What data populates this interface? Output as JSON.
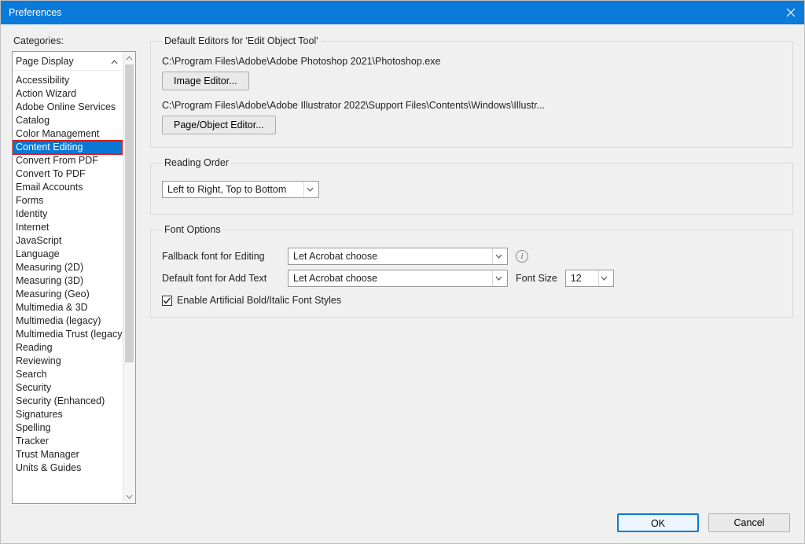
{
  "window_title": "Preferences",
  "categories_label": "Categories:",
  "categories_top": "Page Display",
  "categories": [
    "Accessibility",
    "Action Wizard",
    "Adobe Online Services",
    "Catalog",
    "Color Management",
    "Content Editing",
    "Convert From PDF",
    "Convert To PDF",
    "Email Accounts",
    "Forms",
    "Identity",
    "Internet",
    "JavaScript",
    "Language",
    "Measuring (2D)",
    "Measuring (3D)",
    "Measuring (Geo)",
    "Multimedia & 3D",
    "Multimedia (legacy)",
    "Multimedia Trust (legacy)",
    "Reading",
    "Reviewing",
    "Search",
    "Security",
    "Security (Enhanced)",
    "Signatures",
    "Spelling",
    "Tracker",
    "Trust Manager",
    "Units & Guides"
  ],
  "selected_category_index": 5,
  "editors": {
    "group_title": "Default Editors for 'Edit Object Tool'",
    "image_path": "C:\\Program Files\\Adobe\\Adobe Photoshop 2021\\Photoshop.exe",
    "image_button": "Image Editor...",
    "page_path": "C:\\Program Files\\Adobe\\Adobe Illustrator 2022\\Support Files\\Contents\\Windows\\Illustr...",
    "page_button": "Page/Object Editor..."
  },
  "reading_order": {
    "group_title": "Reading Order",
    "value": "Left to Right, Top to Bottom"
  },
  "font_options": {
    "group_title": "Font Options",
    "fallback_label": "Fallback font for Editing",
    "fallback_value": "Let Acrobat choose",
    "default_label": "Default font for Add Text",
    "default_value": "Let Acrobat choose",
    "font_size_label": "Font Size",
    "font_size_value": "12",
    "checkbox_label": "Enable Artificial Bold/Italic Font Styles",
    "checkbox_checked": true
  },
  "footer": {
    "ok": "OK",
    "cancel": "Cancel"
  }
}
